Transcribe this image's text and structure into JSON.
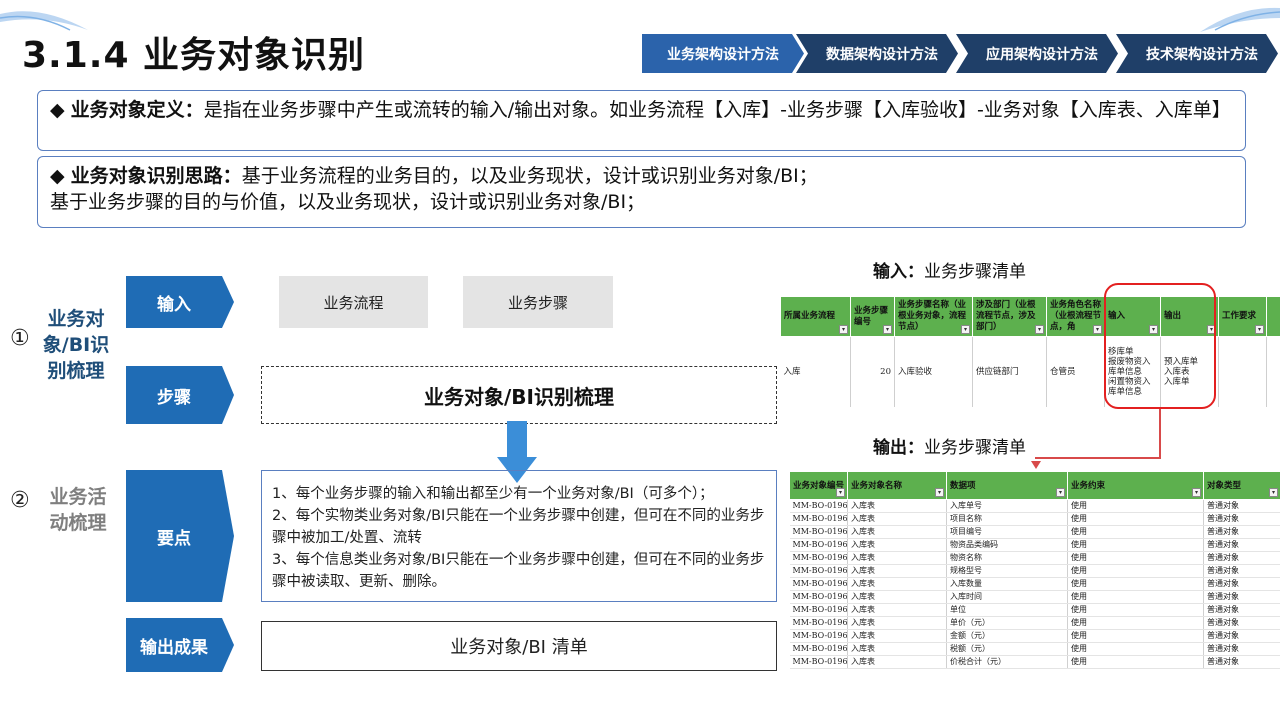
{
  "title": "3.1.4 业务对象识别",
  "nav": [
    "业务架构设计方法",
    "数据架构设计方法",
    "应用架构设计方法",
    "技术架构设计方法"
  ],
  "definition": {
    "bullet": "◆",
    "label": "业务对象定义：",
    "text": "是指在业务步骤中产生或流转的输入/输出对象。如业务流程【入库】-业务步骤【入库验收】-业务对象【入库表、入库单】"
  },
  "approach": {
    "bullet": "◆",
    "label": "业务对象识别思路：",
    "line1": "基于业务流程的业务目的，以及业务现状，设计或识别业务对象/BI；",
    "line2": "基于业务步骤的目的与价值，以及业务现状，设计或识别业务对象/BI；"
  },
  "left": {
    "step1_num": "①",
    "step1_label": "业务对象/BI识别梳理",
    "step2_num": "②",
    "step2_label": "业务活动梳理"
  },
  "tags": {
    "input": "输入",
    "step": "步骤",
    "key": "要点",
    "output": "输出成果"
  },
  "inputs": [
    "业务流程",
    "业务步骤"
  ],
  "step_box": "业务对象/BI识别梳理",
  "key_points": [
    "1、每个业务步骤的输入和输出都至少有一个业务对象/BI（可多个）；",
    "2、每个实物类业务对象/BI只能在一个业务步骤中创建，但可在不同的业务步骤中被加工/处置、流转",
    "3、每个信息类业务对象/BI只能在一个业务步骤中创建，但可在不同的业务步骤中被读取、更新、删除。"
  ],
  "output_box": "业务对象/BI 清单",
  "input_section": {
    "label": "输入：",
    "text": "业务步骤清单"
  },
  "output_section": {
    "label": "输出：",
    "text": "业务步骤清单"
  },
  "input_table": {
    "headers": [
      "所属业务流程",
      "业务步骤编号",
      "业务步骤名称（业根业务对象，流程节点）",
      "涉及部门（业根流程节点，涉及部门）",
      "业务角色名称（业根流程节点，角",
      "输入",
      "输出",
      "工作要求",
      ""
    ],
    "row": {
      "process": "入库",
      "number": "20",
      "step": "入库验收",
      "dept": "供应链部门",
      "role": "仓管员",
      "input": "移库单\n报废物资入库单信息\n闲置物资入库单信息",
      "output": "预入库单\n入库表\n入库单",
      "req": "",
      "extra": ""
    }
  },
  "output_table": {
    "headers": [
      "业务对象编号",
      "业务对象名称",
      "数据项",
      "业务约束",
      "对象类型"
    ],
    "rows": [
      [
        "MM-BO-0196",
        "入库表",
        "入库单号",
        "使用",
        "普通对象"
      ],
      [
        "MM-BO-0196",
        "入库表",
        "项目名称",
        "使用",
        "普通对象"
      ],
      [
        "MM-BO-0196",
        "入库表",
        "项目编号",
        "使用",
        "普通对象"
      ],
      [
        "MM-BO-0196",
        "入库表",
        "物资品类编码",
        "使用",
        "普通对象"
      ],
      [
        "MM-BO-0196",
        "入库表",
        "物资名称",
        "使用",
        "普通对象"
      ],
      [
        "MM-BO-0196",
        "入库表",
        "规格型号",
        "使用",
        "普通对象"
      ],
      [
        "MM-BO-0196",
        "入库表",
        "入库数量",
        "使用",
        "普通对象"
      ],
      [
        "MM-BO-0196",
        "入库表",
        "入库时间",
        "使用",
        "普通对象"
      ],
      [
        "MM-BO-0196",
        "入库表",
        "单位",
        "使用",
        "普通对象"
      ],
      [
        "MM-BO-0196",
        "入库表",
        "单价（元）",
        "使用",
        "普通对象"
      ],
      [
        "MM-BO-0196",
        "入库表",
        "金额（元）",
        "使用",
        "普通对象"
      ],
      [
        "MM-BO-0196",
        "入库表",
        "税额（元）",
        "使用",
        "普通对象"
      ],
      [
        "MM-BO-0196",
        "入库表",
        "价税合计（元）",
        "使用",
        "普通对象"
      ]
    ]
  },
  "colors": {
    "nav_blue": "#2b63ab",
    "nav_dark": "#1f3f68",
    "tag_blue": "#1f6cb5",
    "table_green": "#5db04e",
    "highlight_red": "#e32020"
  }
}
